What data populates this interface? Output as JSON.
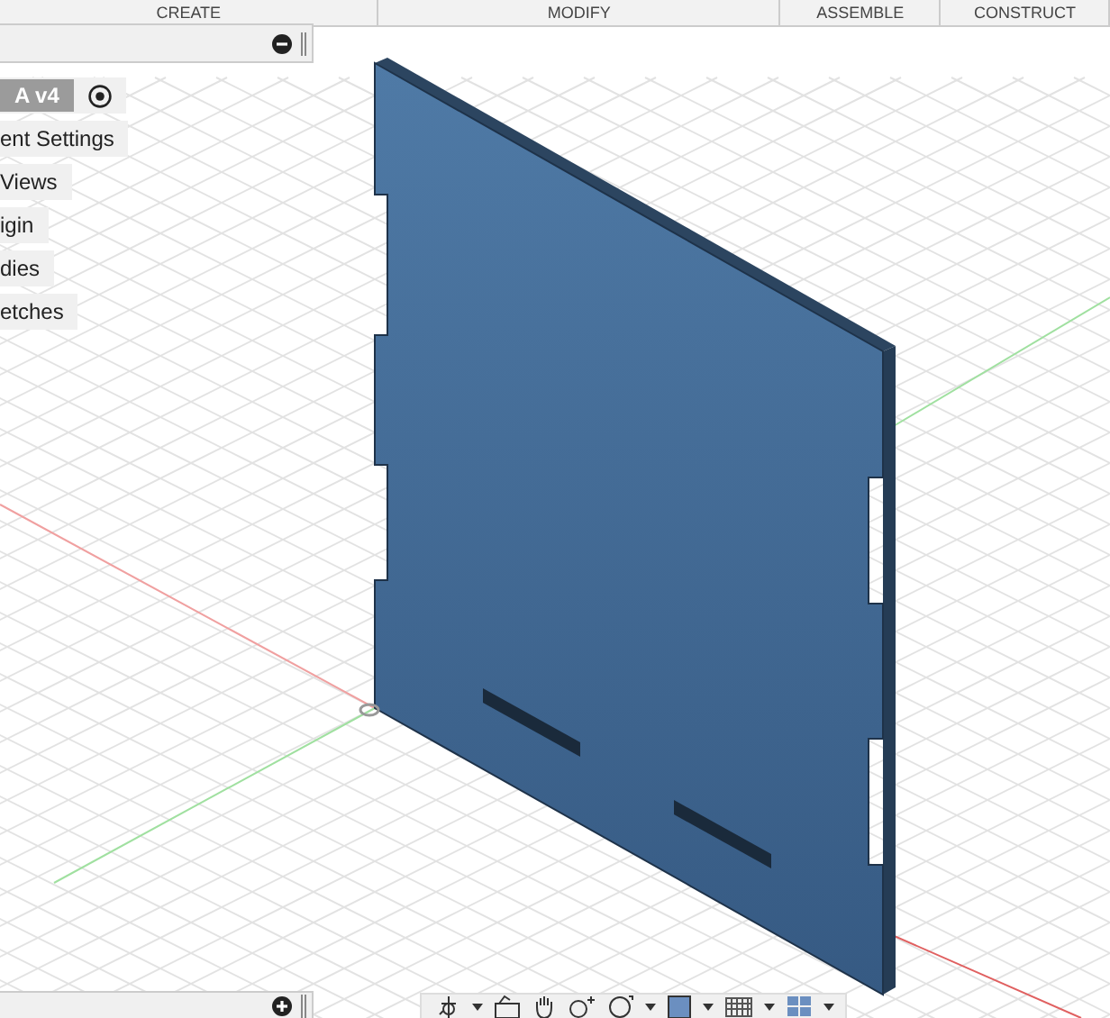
{
  "toolbar": {
    "tabs": [
      {
        "label": "CREATE"
      },
      {
        "label": "MODIFY"
      },
      {
        "label": "ASSEMBLE"
      },
      {
        "label": "CONSTRUCT"
      }
    ]
  },
  "browser": {
    "component": {
      "name": "A v4"
    },
    "items": [
      {
        "label": "ent Settings"
      },
      {
        "label": "Views"
      },
      {
        "label": "igin"
      },
      {
        "label": "dies"
      },
      {
        "label": "etches"
      }
    ]
  }
}
